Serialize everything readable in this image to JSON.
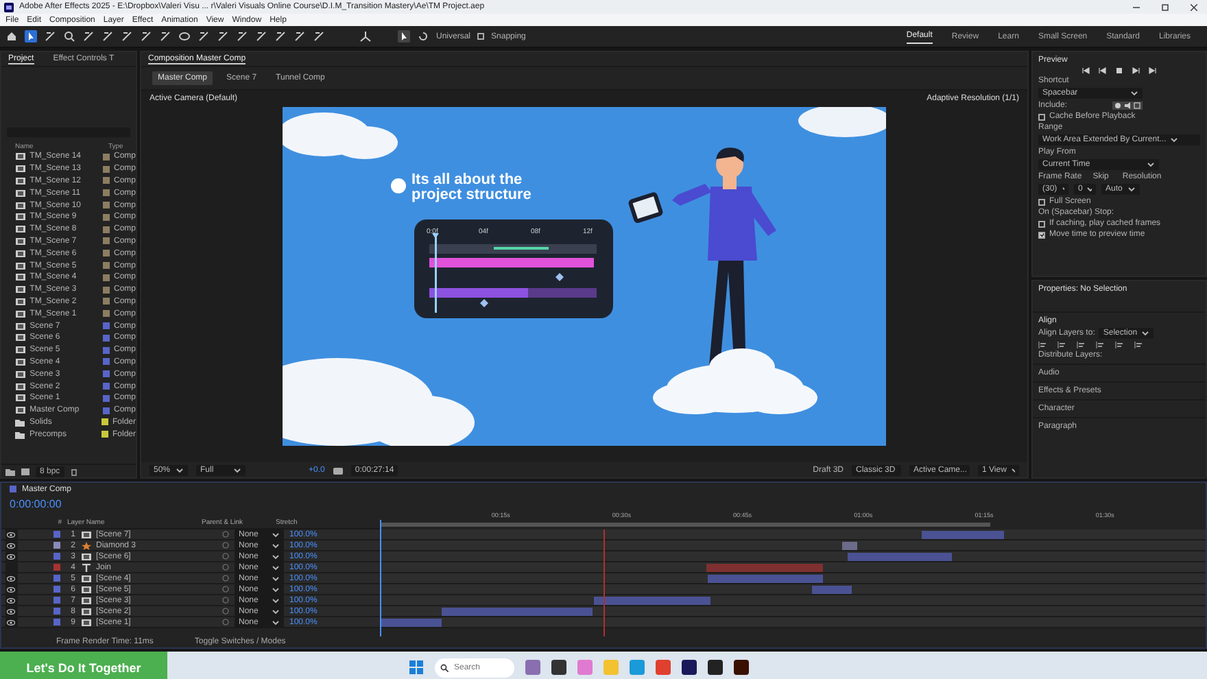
{
  "window": {
    "title": "Adobe After Effects 2025 - E:\\Dropbox\\Valeri Visu ... r\\Valeri Visuals Online Course\\D.I.M_Transition Mastery\\Ae\\TM Project.aep"
  },
  "menu": [
    "File",
    "Edit",
    "Composition",
    "Layer",
    "Effect",
    "Animation",
    "View",
    "Window",
    "Help"
  ],
  "toolbar": {
    "axis_mode": "Universal",
    "snapping": "Snapping",
    "snapping_on": false
  },
  "workspaces": [
    {
      "label": "Default",
      "selected": true
    },
    {
      "label": "Review",
      "selected": false
    },
    {
      "label": "Learn",
      "selected": false
    },
    {
      "label": "Small Screen",
      "selected": false
    },
    {
      "label": "Standard",
      "selected": false
    },
    {
      "label": "Libraries",
      "selected": false
    }
  ],
  "project": {
    "tabs": [
      {
        "label": "Project",
        "selected": true
      },
      {
        "label": "Effect Controls T",
        "selected": false
      }
    ],
    "columns": [
      "Name",
      "Type"
    ],
    "items": [
      {
        "name": "TM_Scene 14",
        "type": "Comp",
        "kind": "comp",
        "color": "#8c7d62",
        "selected": false
      },
      {
        "name": "TM_Scene 13",
        "type": "Comp",
        "kind": "comp",
        "color": "#8c7d62",
        "selected": false
      },
      {
        "name": "TM_Scene 12",
        "type": "Comp",
        "kind": "comp",
        "color": "#8c7d62",
        "selected": false
      },
      {
        "name": "TM_Scene 11",
        "type": "Comp",
        "kind": "comp",
        "color": "#8c7d62",
        "selected": false
      },
      {
        "name": "TM_Scene 10",
        "type": "Comp",
        "kind": "comp",
        "color": "#8c7d62",
        "selected": false
      },
      {
        "name": "TM_Scene 9",
        "type": "Comp",
        "kind": "comp",
        "color": "#8c7d62",
        "selected": false
      },
      {
        "name": "TM_Scene 8",
        "type": "Comp",
        "kind": "comp",
        "color": "#8c7d62",
        "selected": false
      },
      {
        "name": "TM_Scene 7",
        "type": "Comp",
        "kind": "comp",
        "color": "#8c7d62",
        "selected": false
      },
      {
        "name": "TM_Scene 6",
        "type": "Comp",
        "kind": "comp",
        "color": "#8c7d62",
        "selected": false
      },
      {
        "name": "TM_Scene 5",
        "type": "Comp",
        "kind": "comp",
        "color": "#8c7d62",
        "selected": false
      },
      {
        "name": "TM_Scene 4",
        "type": "Comp",
        "kind": "comp",
        "color": "#8c7d62",
        "selected": false
      },
      {
        "name": "TM_Scene 3",
        "type": "Comp",
        "kind": "comp",
        "color": "#8c7d62",
        "selected": false
      },
      {
        "name": "TM_Scene 2",
        "type": "Comp",
        "kind": "comp",
        "color": "#8c7d62",
        "selected": false
      },
      {
        "name": "TM_Scene 1",
        "type": "Comp",
        "kind": "comp",
        "color": "#8c7d62",
        "selected": false
      },
      {
        "name": "Scene 7",
        "type": "Comp",
        "kind": "comp",
        "color": "#5865c8",
        "selected": false
      },
      {
        "name": "Scene 6",
        "type": "Comp",
        "kind": "comp",
        "color": "#5865c8",
        "selected": false
      },
      {
        "name": "Scene 5",
        "type": "Comp",
        "kind": "comp",
        "color": "#5865c8",
        "selected": false
      },
      {
        "name": "Scene 4",
        "type": "Comp",
        "kind": "comp",
        "color": "#5865c8",
        "selected": false
      },
      {
        "name": "Scene 3",
        "type": "Comp",
        "kind": "comp",
        "color": "#5865c8",
        "selected": false
      },
      {
        "name": "Scene 2",
        "type": "Comp",
        "kind": "comp",
        "color": "#5865c8",
        "selected": false
      },
      {
        "name": "Scene 1",
        "type": "Comp",
        "kind": "comp",
        "color": "#5865c8",
        "selected": false
      },
      {
        "name": "Master Comp",
        "type": "Comp",
        "kind": "comp",
        "color": "#5865c8",
        "selected": false
      },
      {
        "name": "Solids",
        "type": "Folder",
        "kind": "folder",
        "color": "#c8c83c",
        "selected": false
      },
      {
        "name": "Precomps",
        "type": "Folder",
        "kind": "folder",
        "color": "#c8c83c",
        "selected": false
      }
    ],
    "bit_depth": "8 bpc"
  },
  "composition": {
    "tab": "Composition Master Comp",
    "breadcrumbs": [
      {
        "label": "Master Comp",
        "selected": true
      },
      {
        "label": "Scene 7",
        "selected": false
      },
      {
        "label": "Tunnel Comp",
        "selected": false
      }
    ],
    "camera": "Active Camera (Default)",
    "resolution_note": "Adaptive Resolution (1/1)",
    "slide": {
      "heading": "Its all about the project structure",
      "ticks": [
        "0:0f",
        "04f",
        "08f",
        "12f"
      ]
    },
    "viewer_bar": {
      "zoom": "50%",
      "quality": "Full",
      "exposure": "+0.0",
      "timecode": "0:00:27:14",
      "draft": "Draft 3D",
      "renderer": "Classic 3D",
      "camera": "Active Came...",
      "views": "1 View"
    }
  },
  "preview": {
    "title": "Preview",
    "shortcut_label": "Shortcut",
    "shortcut": "Spacebar",
    "include_label": "Include:",
    "cache_before_playback": {
      "label": "Cache Before Playback",
      "checked": false
    },
    "range_label": "Range",
    "range": "Work Area Extended By Current...",
    "play_from_label": "Play From",
    "play_from": "Current Time",
    "frame_rate_label": "Frame Rate",
    "frame_rate": "(30)",
    "skip_label": "Skip",
    "skip": "0",
    "resolution_label": "Resolution",
    "resolution": "Auto",
    "full_screen": {
      "label": "Full Screen",
      "checked": false
    },
    "stop_label": "On (Spacebar) Stop:",
    "stop_options": [
      {
        "label": "If caching, play cached frames",
        "checked": false
      },
      {
        "label": "Move time to preview time",
        "checked": true
      }
    ]
  },
  "properties": {
    "title": "Properties: No Selection"
  },
  "align": {
    "title": "Align",
    "align_to_label": "Align Layers to:",
    "align_to": "Selection",
    "distribute_label": "Distribute Layers:"
  },
  "sections": [
    "Audio",
    "Effects & Presets",
    "Character",
    "Paragraph"
  ],
  "timeline": {
    "tab": "Master Comp",
    "time": "0:00:00:00",
    "columns": [
      "#",
      "Layer Name",
      "Parent & Link",
      "Stretch"
    ],
    "ruler": [
      "00:15s",
      "00:30s",
      "00:45s",
      "01:00s",
      "01:15s",
      "01:30s"
    ],
    "layers": [
      {
        "number": "1",
        "name": "[Scene 7]",
        "kind": "comp",
        "color": "#5865c8",
        "visible": true,
        "parent": "None",
        "stretch": "100.0%"
      },
      {
        "number": "2",
        "name": "Diamond 3",
        "kind": "shape",
        "color": "#8a8ab8",
        "visible": true,
        "parent": "None",
        "stretch": "100.0%"
      },
      {
        "number": "3",
        "name": "[Scene 6]",
        "kind": "comp",
        "color": "#5865c8",
        "visible": true,
        "parent": "None",
        "stretch": "100.0%"
      },
      {
        "number": "4",
        "name": "Join",
        "kind": "text",
        "color": "#a83232",
        "visible": false,
        "parent": "None",
        "stretch": "100.0%"
      },
      {
        "number": "5",
        "name": "[Scene 4]",
        "kind": "comp",
        "color": "#5865c8",
        "visible": true,
        "parent": "None",
        "stretch": "100.0%"
      },
      {
        "number": "6",
        "name": "[Scene 5]",
        "kind": "comp",
        "color": "#5865c8",
        "visible": true,
        "parent": "None",
        "stretch": "100.0%"
      },
      {
        "number": "7",
        "name": "[Scene 3]",
        "kind": "comp",
        "color": "#5865c8",
        "visible": true,
        "parent": "None",
        "stretch": "100.0%"
      },
      {
        "number": "8",
        "name": "[Scene 2]",
        "kind": "comp",
        "color": "#5865c8",
        "visible": true,
        "parent": "None",
        "stretch": "100.0%"
      },
      {
        "number": "9",
        "name": "[Scene 1]",
        "kind": "comp",
        "color": "#5865c8",
        "visible": true,
        "parent": "None",
        "stretch": "100.0%"
      }
    ],
    "render_time": "Frame Render Time: 11ms",
    "toggle": "Toggle Switches / Modes"
  },
  "banner": "Let's Do It Together",
  "taskbar": {
    "search_placeholder": "Search"
  }
}
